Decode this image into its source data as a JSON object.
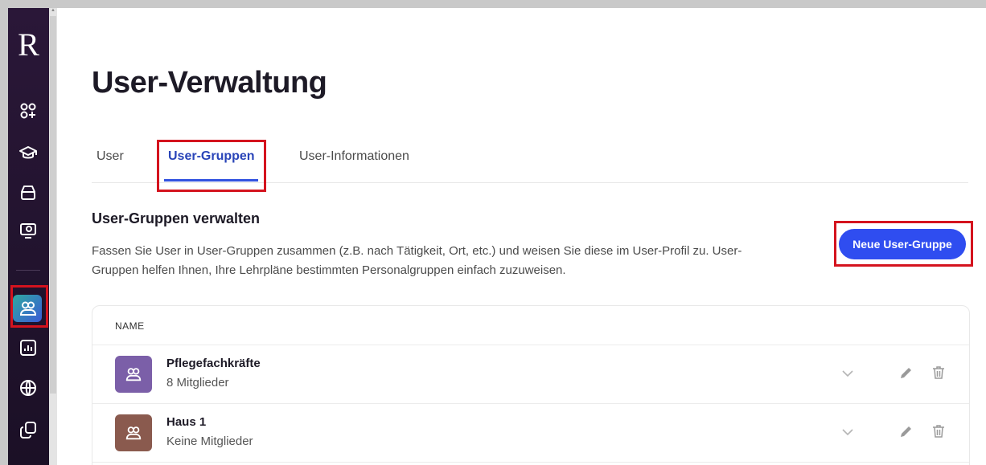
{
  "sidebar": {
    "logo": "R",
    "items": [
      {
        "icon": "apps-plus-icon"
      },
      {
        "icon": "graduation-cap-icon"
      },
      {
        "icon": "stack-icon"
      },
      {
        "icon": "monitor-user-icon"
      },
      {
        "icon": "users-icon",
        "active": true
      },
      {
        "icon": "chart-icon"
      },
      {
        "icon": "globe-icon"
      },
      {
        "icon": "copy-icon"
      }
    ],
    "accent_from": "#2fa9a0",
    "accent_to": "#3b5bd6"
  },
  "page": {
    "title": "User-Verwaltung"
  },
  "tabs": [
    {
      "label": "User",
      "active": false
    },
    {
      "label": "User-Gruppen",
      "active": true
    },
    {
      "label": "User-Informationen",
      "active": false
    }
  ],
  "section": {
    "title": "User-Gruppen verwalten",
    "description_line1": "Fassen Sie User in User-Gruppen zusammen (z.B. nach Tätigkeit, Ort, etc.) und weisen Sie diese im User-Profil zu. User-",
    "description_line2": "Gruppen helfen Ihnen, Ihre Lehrpläne bestimmten Personalgruppen einfach zuzuweisen.",
    "new_button": "Neue User-Gruppe"
  },
  "table": {
    "header_name": "NAME",
    "rows": [
      {
        "name": "Pflegefachkräfte",
        "members": "8 Mitglieder",
        "color": "#7b5fa8"
      },
      {
        "name": "Haus 1",
        "members": "Keine Mitglieder",
        "color": "#8a5a4e"
      }
    ]
  },
  "colors": {
    "primary": "#2f4df0",
    "highlight": "#d4131e",
    "sidebar_bg": "#2a1738"
  }
}
